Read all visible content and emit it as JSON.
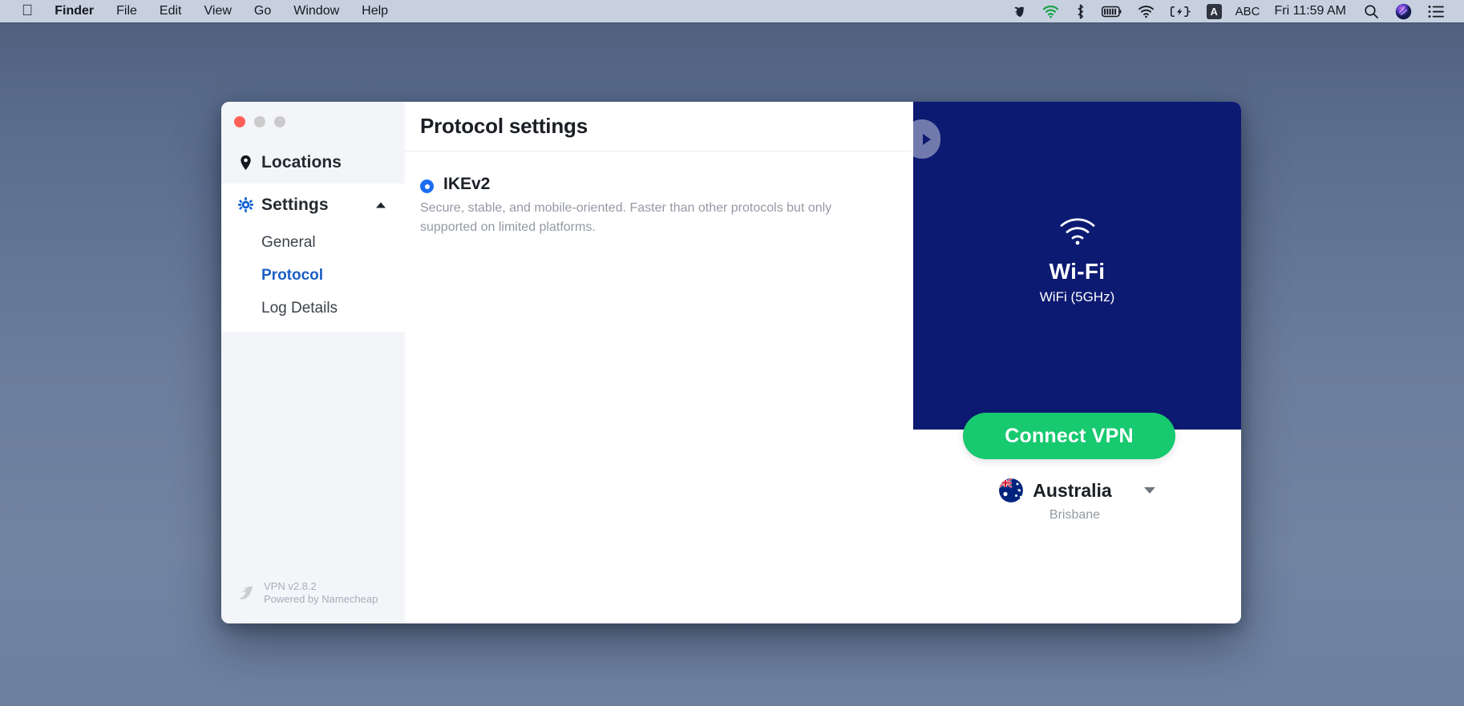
{
  "menubar": {
    "apple_logo": "apple-logo",
    "items": [
      {
        "label": "Finder",
        "bold": true
      },
      {
        "label": "File",
        "bold": false
      },
      {
        "label": "Edit",
        "bold": false
      },
      {
        "label": "View",
        "bold": false
      },
      {
        "label": "Go",
        "bold": false
      },
      {
        "label": "Window",
        "bold": false
      },
      {
        "label": "Help",
        "bold": false
      }
    ],
    "status_icons": [
      "bitwarden-icon",
      "wifi-green-icon",
      "bluetooth-icon",
      "battery-icon",
      "wifi-icon",
      "charging-battery-icon"
    ],
    "input_source_badge": "A",
    "input_source_label": "ABC",
    "clock": "Fri 11:59 AM",
    "search_icon": "search-icon",
    "siri_icon": "siri-icon",
    "control_center_icon": "control-center-icon"
  },
  "window": {
    "traffic_lights": [
      "close",
      "minimize",
      "zoom"
    ],
    "sidebar": {
      "locations": {
        "label": "Locations",
        "icon": "map-pin-icon"
      },
      "settings": {
        "label": "Settings",
        "icon": "gear-icon",
        "caret": "caret-up-icon",
        "expanded": true,
        "children": [
          {
            "label": "General",
            "selected": false
          },
          {
            "label": "Protocol",
            "selected": true
          },
          {
            "label": "Log Details",
            "selected": false
          }
        ]
      },
      "footer": {
        "logo": "namecheap-logo-icon",
        "version": "VPN v2.8.2",
        "powered_by": "Powered by Namecheap"
      }
    },
    "main": {
      "title": "Protocol settings",
      "protocols": [
        {
          "name": "IKEv2",
          "selected": true,
          "description": "Secure, stable, and mobile-oriented. Faster than other protocols but only supported on limited platforms."
        }
      ]
    },
    "right_panel": {
      "pull_tab_icon": "play-triangle-icon",
      "connection_icon": "wifi-icon",
      "connection_title": "Wi-Fi",
      "connection_subtitle": "WiFi (5GHz)",
      "connect_button": "Connect VPN",
      "location": {
        "flag": "australia-flag-icon",
        "country": "Australia",
        "city": "Brisbane",
        "caret": "caret-down-icon"
      }
    }
  },
  "colors": {
    "accent_blue": "#1b6ef3",
    "panel_navy": "#0d1a72",
    "connect_green": "#17c96f",
    "selected_link": "#1c5fc4"
  }
}
